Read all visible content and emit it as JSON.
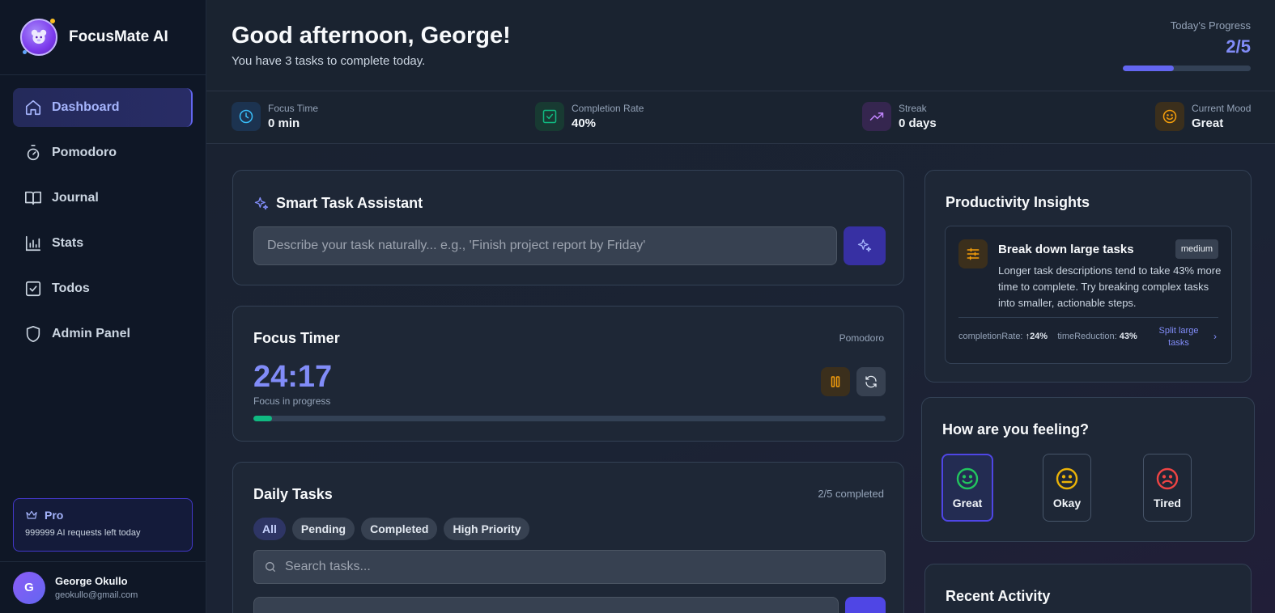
{
  "brand": {
    "name": "FocusMate AI"
  },
  "nav": {
    "items": [
      {
        "label": "Dashboard",
        "icon": "home-icon",
        "active": true
      },
      {
        "label": "Pomodoro",
        "icon": "stopwatch-icon"
      },
      {
        "label": "Journal",
        "icon": "book-icon"
      },
      {
        "label": "Stats",
        "icon": "bar-chart-icon"
      },
      {
        "label": "Todos",
        "icon": "checkbox-icon"
      },
      {
        "label": "Admin Panel",
        "icon": "shield-icon"
      }
    ]
  },
  "plan": {
    "name": "Pro",
    "requests_left": "999999 AI requests left today"
  },
  "user": {
    "initial": "G",
    "name": "George Okullo",
    "email": "geokullo@gmail.com"
  },
  "header": {
    "greeting": "Good afternoon, George!",
    "subtitle": "You have 3 tasks to complete today.",
    "progress_label": "Today's Progress",
    "progress_value": "2/5",
    "progress_fraction": 0.4
  },
  "stats": [
    {
      "label": "Focus Time",
      "value": "0 min",
      "icon": "clock-icon",
      "color": "#38bdf8"
    },
    {
      "label": "Completion Rate",
      "value": "40%",
      "icon": "check-square-icon",
      "color": "#10b981"
    },
    {
      "label": "Streak",
      "value": "0 days",
      "icon": "trending-up-icon",
      "color": "#c084fc"
    },
    {
      "label": "Current Mood",
      "value": "Great",
      "icon": "smile-icon",
      "color": "#f59e0b"
    }
  ],
  "assistant": {
    "title": "Smart Task Assistant",
    "placeholder": "Describe your task naturally... e.g., 'Finish project report by Friday'"
  },
  "timer": {
    "title": "Focus Timer",
    "mode": "Pomodoro",
    "time": "24:17",
    "status": "Focus in progress",
    "progress_fraction": 0.03
  },
  "tasks": {
    "title": "Daily Tasks",
    "count": "2/5 completed",
    "filters": [
      "All",
      "Pending",
      "Completed",
      "High Priority"
    ],
    "active_filter": "All",
    "search_placeholder": "Search tasks..."
  },
  "insights": {
    "title": "Productivity Insights",
    "item": {
      "title": "Break down large tasks",
      "badge": "medium",
      "description": "Longer task descriptions tend to take 43% more time to complete. Try breaking complex tasks into smaller, actionable steps.",
      "metric1_label": "completionRate:",
      "metric1_value": "↑24%",
      "metric2_label": "timeReduction:",
      "metric2_value": "43%",
      "action": "Split large tasks",
      "chevron": "›"
    }
  },
  "mood": {
    "title": "How are you feeling?",
    "options": [
      {
        "label": "Great",
        "color": "#22c55e",
        "selected": true
      },
      {
        "label": "Okay",
        "color": "#eab308"
      },
      {
        "label": "Tired",
        "color": "#ef4444"
      }
    ]
  },
  "activity": {
    "title": "Recent Activity"
  }
}
